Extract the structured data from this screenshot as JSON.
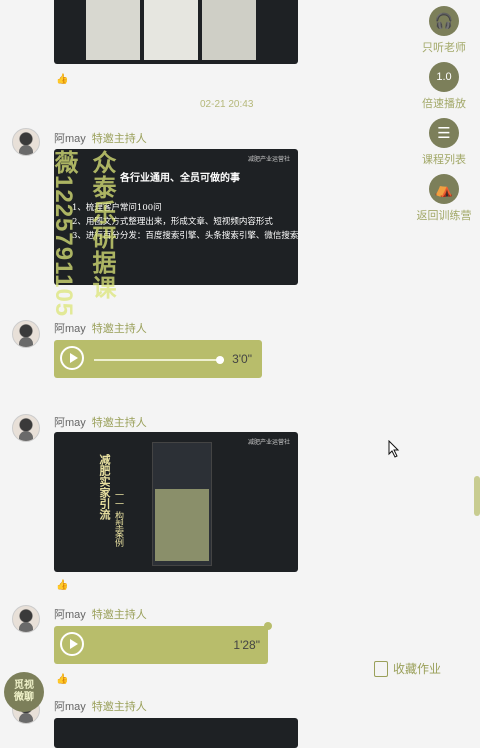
{
  "timestamp": "02-21 20:43",
  "sidebar": {
    "items": [
      {
        "icon": "headphones-icon",
        "glyph": "🎧",
        "label": "只听老师"
      },
      {
        "icon": "speed-icon",
        "glyph": "1.0",
        "label": "倍速播放"
      },
      {
        "icon": "list-icon",
        "glyph": "☰",
        "label": "课程列表"
      },
      {
        "icon": "camp-icon",
        "glyph": "⛺",
        "label": "返回训练营"
      }
    ]
  },
  "messages": [
    {
      "author": "阿may",
      "role": "特邀主持人"
    },
    {
      "author": "阿may",
      "role": "特邀主持人"
    },
    {
      "author": "阿may",
      "role": "特邀主持人"
    },
    {
      "author": "阿may",
      "role": "特邀主持人"
    },
    {
      "author": "阿may",
      "role": "特邀主持人"
    }
  ],
  "slide": {
    "header": "减肥产业运营社",
    "title": "各行业通用、全员可做的事",
    "lines": [
      "1、梳理客户常问100问",
      "2、用图文方式整理出来，形成文章、短视频内容形式",
      "3、进行百分分发：百度搜索引擎、头条搜索引擎、微信搜索引擎"
    ]
  },
  "case_slide": {
    "header": "减肥产业运营社",
    "vertical_title": "减肥实家引流",
    "vertical_sub": "一一 构型案例"
  },
  "voice1": {
    "duration": "3'0\""
  },
  "voice2": {
    "duration": "1'28\""
  },
  "watermark": {
    "line1": "众泰乐研据课",
    "line2": "薇1225791105"
  },
  "bottom_left_badge": "觅视\n微聊",
  "collect_label": "收藏作业",
  "thumb_glyph": "👍"
}
